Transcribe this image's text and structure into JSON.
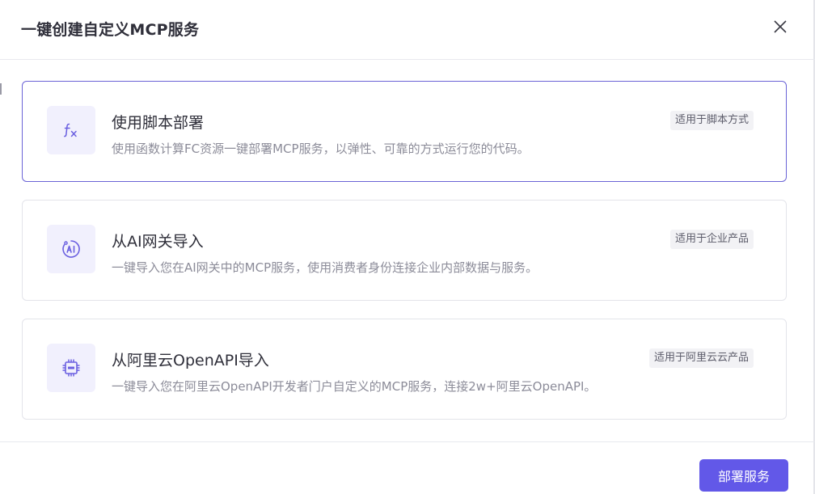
{
  "modal": {
    "title": "一键创建自定义MCP服务",
    "close_icon": "close-icon"
  },
  "options": [
    {
      "id": "script",
      "icon": "function-fx-icon",
      "title": "使用脚本部署",
      "description": "使用函数计算FC资源一键部署MCP服务，以弹性、可靠的方式运行您的代码。",
      "badge": "适用于脚本方式",
      "selected": true
    },
    {
      "id": "ai-gateway",
      "icon": "ai-gateway-icon",
      "title": "从AI网关导入",
      "description": "一键导入您在AI网关中的MCP服务，使用消费者身份连接企业内部数据与服务。",
      "badge": "适用于企业产品",
      "selected": false
    },
    {
      "id": "openapi",
      "icon": "api-chip-icon",
      "title": "从阿里云OpenAPI导入",
      "description": "一键导入您在阿里云OpenAPI开发者门户自定义的MCP服务，连接2w+阿里云OpenAPI。",
      "badge": "适用于阿里云云产品",
      "selected": false
    }
  ],
  "footer": {
    "deploy_label": "部署服务"
  },
  "colors": {
    "accent": "#6258e8",
    "selected_border": "#6a63d6",
    "icon_bg": "#f1f0fd",
    "icon_fg": "#6a5fe0"
  }
}
